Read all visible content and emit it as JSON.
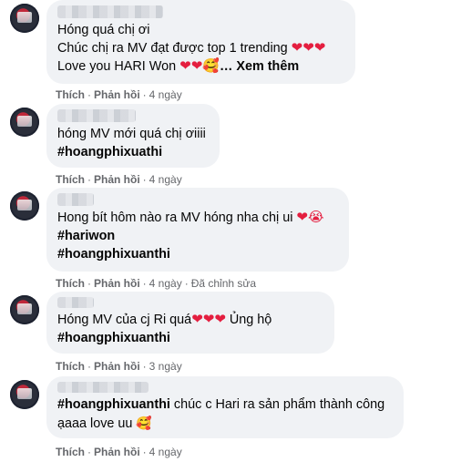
{
  "comments": [
    {
      "lines": [
        "Hóng quá chị ơi",
        "Chúc chị ra MV đạt được top 1 trending",
        "Love you HARI Won"
      ],
      "line_emojis": [
        "",
        "❤❤❤",
        "❤❤🥰"
      ],
      "see_more": "… Xem thêm",
      "actions": {
        "like": "Thích",
        "reply": "Phản hồi",
        "time": "4 ngày"
      }
    },
    {
      "lines": [
        "hóng MV mới quá chị ơiiii",
        "#hoangphixuathi"
      ],
      "line_emojis": [
        "",
        ""
      ],
      "actions": {
        "like": "Thích",
        "reply": "Phản hồi",
        "time": "4 ngày"
      }
    },
    {
      "lines": [
        "Hong bít hôm nào ra MV hóng nha chị ui",
        "#hariwon",
        "#hoangphixuanthi"
      ],
      "line_emojis": [
        "❤😭",
        "",
        ""
      ],
      "actions": {
        "like": "Thích",
        "reply": "Phản hồi",
        "time": "4 ngày",
        "edited": "Đã chỉnh sửa"
      }
    },
    {
      "lines": [
        "Hóng MV của cj Ri quá",
        "#hoangphixuanthi"
      ],
      "line_emojis": [
        "❤❤❤",
        ""
      ],
      "line_suffix": " Ủng hộ",
      "actions": {
        "like": "Thích",
        "reply": "Phản hồi",
        "time": "3 ngày"
      }
    },
    {
      "lines": [
        "#hoangphixuanthi",
        "ạaaa love uu"
      ],
      "line_rest": " chúc c Hari ra sản phẩm thành công",
      "line_emojis": [
        "",
        "🥰"
      ],
      "actions": {
        "like": "Thích",
        "reply": "Phản hồi",
        "time": "4 ngày"
      }
    }
  ],
  "colors": {
    "bubble": "#f0f2f5",
    "meta": "#65676b",
    "heart": "#e41e3f"
  }
}
